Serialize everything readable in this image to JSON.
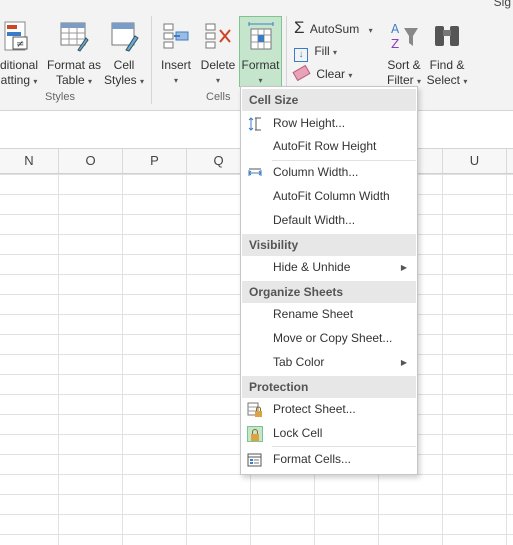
{
  "window": {
    "sign_in": "Sig"
  },
  "ribbon": {
    "styles_group": {
      "label": "Styles",
      "conditional_formatting_l1": "ditional",
      "conditional_formatting_l2": "atting",
      "format_as_table_l1": "Format as",
      "format_as_table_l2": "Table",
      "cell_styles_l1": "Cell",
      "cell_styles_l2": "Styles"
    },
    "cells_group": {
      "label": "Cells",
      "insert": "Insert",
      "delete": "Delete",
      "format": "Format"
    },
    "editing_group": {
      "autosum": "AutoSum",
      "fill": "Fill",
      "clear": "Clear",
      "sort_filter_l1": "Sort &",
      "sort_filter_l2": "Filter",
      "find_select_l1": "Find &",
      "find_select_l2": "Select"
    }
  },
  "columns": [
    "N",
    "O",
    "P",
    "Q",
    "U"
  ],
  "menu": {
    "sections": {
      "cell_size": "Cell Size",
      "visibility": "Visibility",
      "organize_sheets": "Organize Sheets",
      "protection": "Protection"
    },
    "items": {
      "row_height": "Row Height...",
      "autofit_row_height": "AutoFit Row Height",
      "column_width": "Column Width...",
      "autofit_column_width": "AutoFit Column Width",
      "default_width": "Default Width...",
      "hide_unhide": "Hide & Unhide",
      "rename_sheet": "Rename Sheet",
      "move_copy_sheet": "Move or Copy Sheet...",
      "tab_color": "Tab Color",
      "protect_sheet": "Protect Sheet...",
      "lock_cell": "Lock Cell",
      "format_cells": "Format Cells..."
    }
  },
  "colors": {
    "format_active_bg": "#c5e6cd",
    "format_active_border": "#7fc391",
    "section_bg": "#e7e7e7"
  }
}
